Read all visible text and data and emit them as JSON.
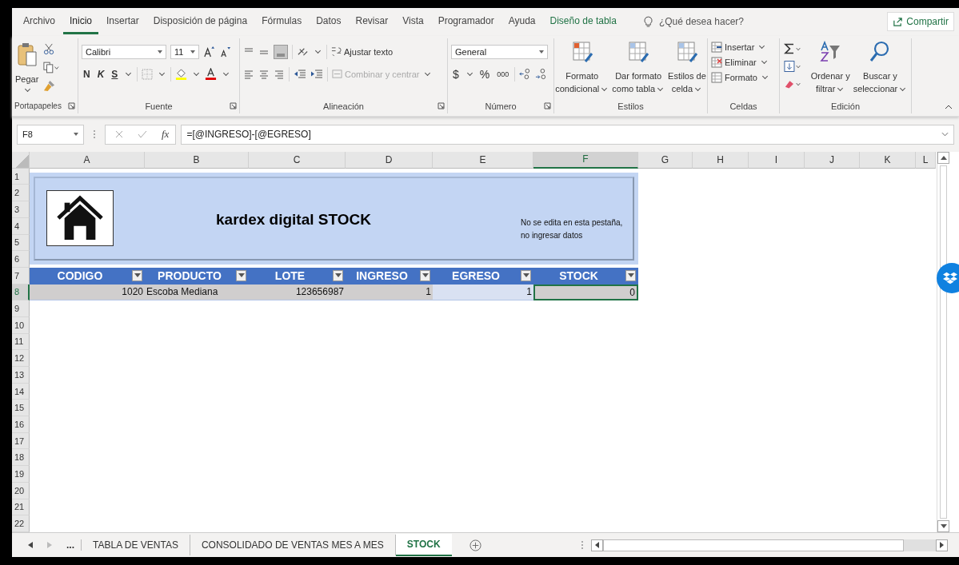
{
  "ribbon_tabs": [
    {
      "label": "Archivo",
      "selected": false,
      "kind": "plain"
    },
    {
      "label": "Inicio",
      "selected": true,
      "kind": "plain"
    },
    {
      "label": "Insertar",
      "selected": false,
      "kind": "plain"
    },
    {
      "label": "Disposición de página",
      "selected": false,
      "kind": "plain"
    },
    {
      "label": "Fórmulas",
      "selected": false,
      "kind": "plain"
    },
    {
      "label": "Datos",
      "selected": false,
      "kind": "plain"
    },
    {
      "label": "Revisar",
      "selected": false,
      "kind": "plain"
    },
    {
      "label": "Vista",
      "selected": false,
      "kind": "plain"
    },
    {
      "label": "Programador",
      "selected": false,
      "kind": "plain"
    },
    {
      "label": "Ayuda",
      "selected": false,
      "kind": "plain"
    },
    {
      "label": "Diseño de tabla",
      "selected": false,
      "kind": "context"
    }
  ],
  "tell_me": "¿Qué desea hacer?",
  "share_button": "Compartir",
  "ribbon": {
    "clipboard": {
      "label": "Portapapeles",
      "paste": "Pegar"
    },
    "font": {
      "label": "Fuente",
      "family": "Calibri",
      "size": "11",
      "bold": "N",
      "italic": "K",
      "underline": "S"
    },
    "alignment": {
      "label": "Alineación",
      "wrap": "Ajustar texto",
      "merge": {
        "text": "Combinar y centrar",
        "disabled": true
      }
    },
    "number": {
      "label": "Número",
      "format": "General",
      "currency": "$",
      "percent": "%",
      "thousands": "000"
    },
    "styles": {
      "label": "Estilos",
      "buttons": [
        {
          "lines": [
            "Formato",
            "condicional"
          ]
        },
        {
          "lines": [
            "Dar formato",
            "como tabla"
          ]
        },
        {
          "lines": [
            "Estilos de",
            "celda"
          ]
        }
      ]
    },
    "cells": {
      "label": "Celdas",
      "buttons": [
        "Insertar",
        "Eliminar",
        "Formato"
      ]
    },
    "editing": {
      "label": "Edición",
      "buttons": [
        {
          "lines": [
            "Ordenar y",
            "filtrar"
          ]
        },
        {
          "lines": [
            "Buscar y",
            "seleccionar"
          ]
        }
      ]
    }
  },
  "formula_bar": {
    "name_box": "F8",
    "fx": "fx",
    "formula": "=[@INGRESO]-[@EGRESO]"
  },
  "columns": [
    {
      "label": "A",
      "selected": false
    },
    {
      "label": "B",
      "selected": false
    },
    {
      "label": "C",
      "selected": false
    },
    {
      "label": "D",
      "selected": false
    },
    {
      "label": "E",
      "selected": false
    },
    {
      "label": "F",
      "selected": true
    },
    {
      "label": "G",
      "selected": false
    },
    {
      "label": "H",
      "selected": false
    },
    {
      "label": "I",
      "selected": false
    },
    {
      "label": "J",
      "selected": false
    },
    {
      "label": "K",
      "selected": false
    },
    {
      "label": "L",
      "selected": false
    }
  ],
  "rows": [
    {
      "label": "1",
      "selected": false
    },
    {
      "label": "2",
      "selected": false
    },
    {
      "label": "3",
      "selected": false
    },
    {
      "label": "4",
      "selected": false
    },
    {
      "label": "5",
      "selected": false
    },
    {
      "label": "6",
      "selected": false
    },
    {
      "label": "7",
      "selected": false
    },
    {
      "label": "8",
      "selected": true
    },
    {
      "label": "9",
      "selected": false
    },
    {
      "label": "10",
      "selected": false
    },
    {
      "label": "11",
      "selected": false
    },
    {
      "label": "12",
      "selected": false
    },
    {
      "label": "13",
      "selected": false
    },
    {
      "label": "14",
      "selected": false
    },
    {
      "label": "15",
      "selected": false
    },
    {
      "label": "16",
      "selected": false
    },
    {
      "label": "17",
      "selected": false
    },
    {
      "label": "18",
      "selected": false
    },
    {
      "label": "19",
      "selected": false
    },
    {
      "label": "20",
      "selected": false
    },
    {
      "label": "21",
      "selected": false
    },
    {
      "label": "22",
      "selected": false
    }
  ],
  "banner": {
    "title": "kardex digital STOCK",
    "note": "No se edita en esta pestaña, no ingresar datos"
  },
  "table": {
    "columns": [
      "CODIGO",
      "PRODUCTO",
      "LOTE",
      "INGRESO",
      "EGRESO",
      "STOCK"
    ],
    "rows": [
      {
        "cells": [
          {
            "text": "1020",
            "kind": "number",
            "selected": false
          },
          {
            "text": "Escoba Mediana",
            "kind": "text",
            "selected": false
          },
          {
            "text": "123656987",
            "kind": "number",
            "selected": false
          },
          {
            "text": "1",
            "kind": "number",
            "selected": false
          },
          {
            "text": "1",
            "kind": "number",
            "selected": false
          },
          {
            "text": "0",
            "kind": "number",
            "selected": true
          }
        ]
      }
    ]
  },
  "sheet_more": "...",
  "sheet_tabs": [
    {
      "label": "TABLA DE VENTAS",
      "selected": false
    },
    {
      "label": "CONSOLIDADO DE VENTAS MES A MES",
      "selected": false
    },
    {
      "label": "STOCK",
      "selected": true
    }
  ]
}
